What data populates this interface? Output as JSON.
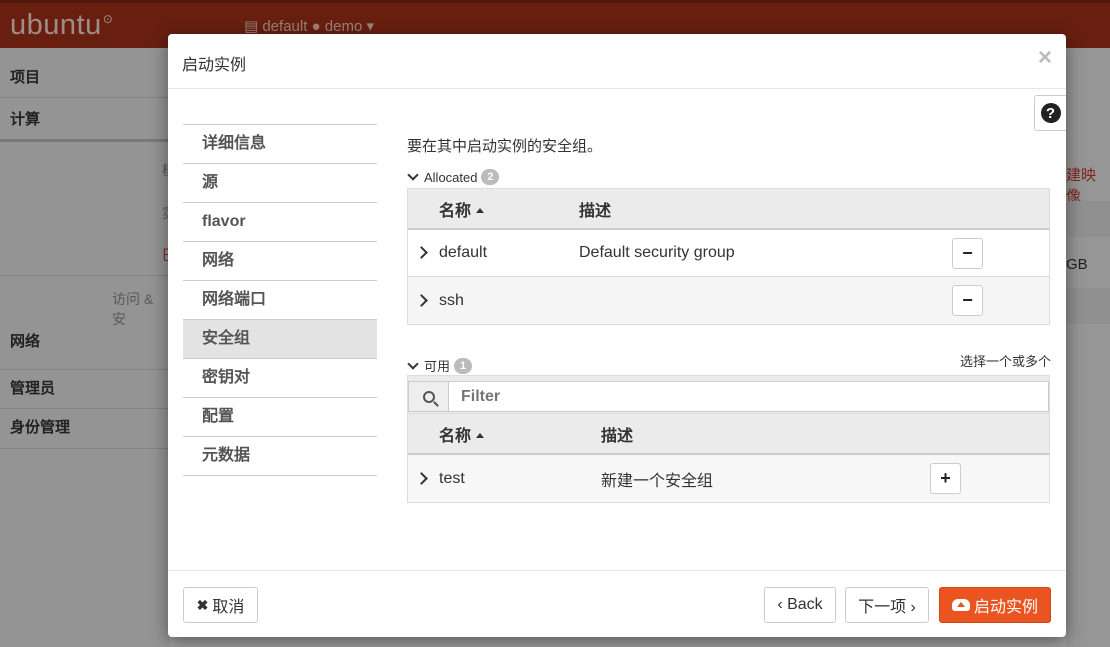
{
  "app": {
    "logo": "ubuntu",
    "project_switcher": "default ● demo"
  },
  "bg_sidebar": {
    "items": [
      "项目",
      "计算",
      "访问 & 安",
      "网络",
      "管理员",
      "身份管理"
    ],
    "clipped": [
      "模",
      "实",
      "巴"
    ]
  },
  "bg_right": {
    "create_image": "建映像",
    "size": "GB"
  },
  "modal": {
    "title": "启动实例",
    "close": "×",
    "help": "?",
    "nav": [
      "详细信息",
      "源",
      "flavor",
      "网络",
      "网络端口",
      "安全组",
      "密钥对",
      "配置",
      "元数据"
    ],
    "active_nav": "安全组",
    "description": "要在其中启动实例的安全组。",
    "allocated": {
      "label": "Allocated",
      "count": "2",
      "headers": {
        "name": "名称",
        "desc": "描述"
      },
      "rows": [
        {
          "name": "default",
          "desc": "Default security group",
          "action": "−"
        },
        {
          "name": "ssh",
          "desc": "",
          "action": "−"
        }
      ]
    },
    "available": {
      "label": "可用",
      "count": "1",
      "hint": "选择一个或多个",
      "filter_placeholder": "Filter",
      "headers": {
        "name": "名称",
        "desc": "描述"
      },
      "rows": [
        {
          "name": "test",
          "desc": "新建一个安全组",
          "action": "+"
        }
      ]
    },
    "footer": {
      "cancel": "取消",
      "back": "‹ Back",
      "next": "下一项 ›",
      "launch": "启动实例"
    }
  },
  "colors": {
    "brand": "#a0301a",
    "primary": "#e95420"
  }
}
